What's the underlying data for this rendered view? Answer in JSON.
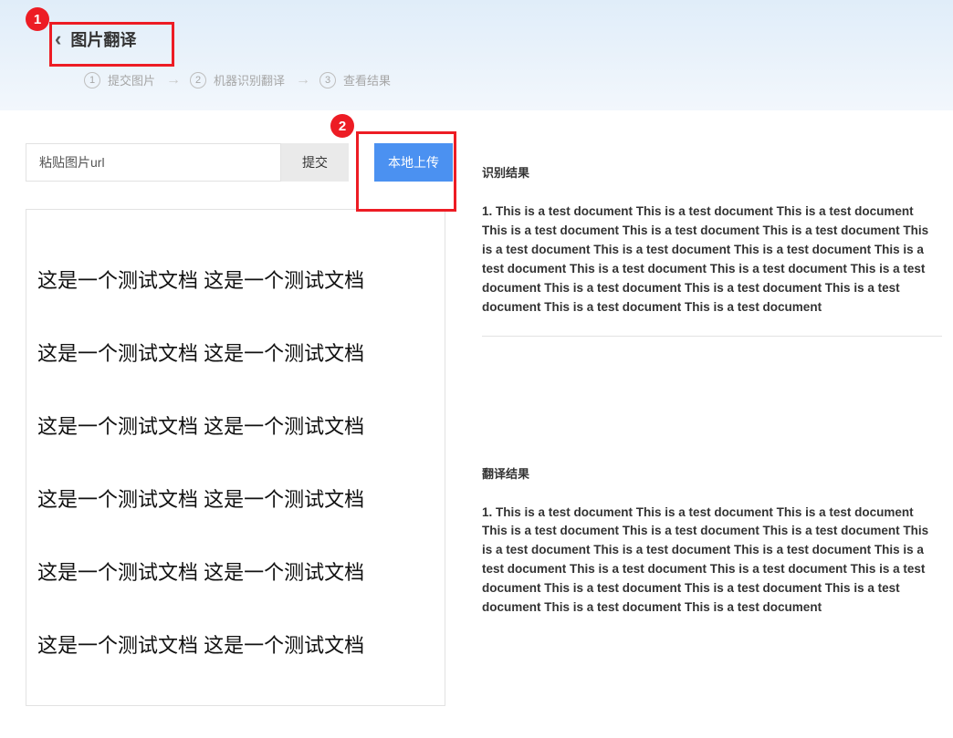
{
  "header": {
    "title": "图片翻译",
    "steps": [
      {
        "num": "1",
        "label": "提交图片"
      },
      {
        "num": "2",
        "label": "机器识别翻译"
      },
      {
        "num": "3",
        "label": "查看结果"
      }
    ]
  },
  "input": {
    "placeholder": "粘贴图片url",
    "submit_label": "提交",
    "upload_label": "本地上传"
  },
  "preview_lines": [
    "这是一个测试文档  这是一个测试文档",
    "这是一个测试文档  这是一个测试文档",
    "这是一个测试文档  这是一个测试文档",
    "这是一个测试文档  这是一个测试文档",
    "这是一个测试文档  这是一个测试文档",
    "这是一个测试文档  这是一个测试文档"
  ],
  "results": {
    "recognize_title": "识别结果",
    "recognize_text": "1. This is a test document This is a test document This is a test document This is a test document This is a test document This is a test document This is a test document This is a test document This is a test document This is a test document This is a test document This is a test document This is a test document This is a test document This is a test document This is a test document This is a test document This is a test document",
    "translate_title": "翻译结果",
    "translate_text": "1. This is a test document This is a test document This is a test document This is a test document This is a test document This is a test document This is a test document This is a test document This is a test document This is a test document This is a test document This is a test document This is a test document This is a test document This is a test document This is a test document This is a test document This is a test document"
  },
  "callouts": {
    "c1": "1",
    "c2": "2"
  }
}
